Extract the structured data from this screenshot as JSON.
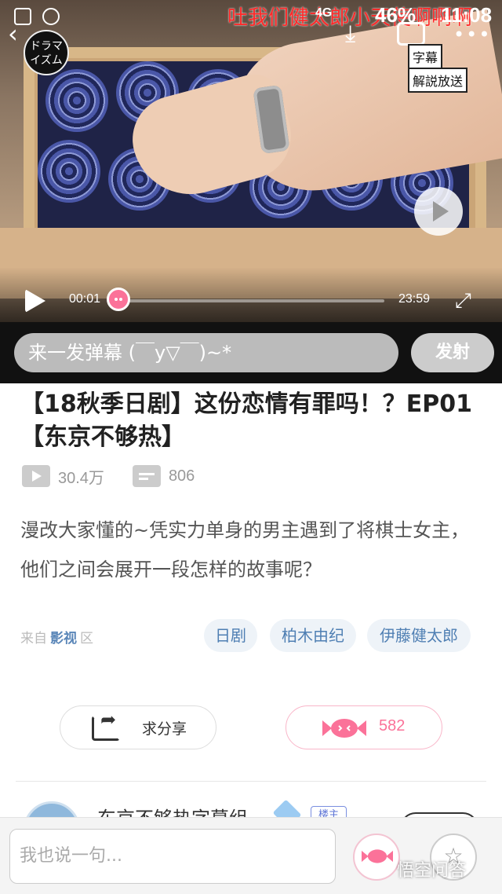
{
  "status_bar": {
    "battery": "46%",
    "time": "11:08",
    "network": "4G",
    "overlay_text": "吐我们健太郎小天使啊啊啊"
  },
  "video": {
    "logo_text": "ドラマイズム",
    "subtitle_tag": "字幕",
    "broadcast_tag": "解説放送",
    "current_time": "00:01",
    "duration": "23:59",
    "progress_fraction": 0.003,
    "accent_color": "#fb7299"
  },
  "danmaku": {
    "placeholder": "来一发弹幕 (￣y▽￣)~*",
    "send_label": "发射"
  },
  "content": {
    "title": "【18秋季日剧】这份恋情有罪吗！？EP01【东京不够热】",
    "play_count": "30.4万",
    "danmaku_count": "806",
    "description": "漫改大家懂的~凭实力单身的男主遇到了将棋士女主，他们之间会展开一段怎样的故事呢？",
    "source_prefix": "来自",
    "source_zone": "影视",
    "source_suffix": "区",
    "tags": [
      "日剧",
      "柏木由纪",
      "伊藤健太郎"
    ],
    "share_label": "求分享",
    "candy_count": "582"
  },
  "comment_peek": {
    "name": "东京不够热字幕组",
    "badge": "楼主"
  },
  "bottom_bar": {
    "comment_placeholder": "我也说一句...",
    "corner_watermark": "悟空问答"
  },
  "icons": {
    "back": "back-arrow-icon",
    "download": "download-icon",
    "tv": "tv-icon",
    "more": "more-dots-icon",
    "play": "play-icon",
    "fullscreen": "fullscreen-icon",
    "share": "share-icon",
    "candy": "candy-icon",
    "star": "star-icon"
  }
}
